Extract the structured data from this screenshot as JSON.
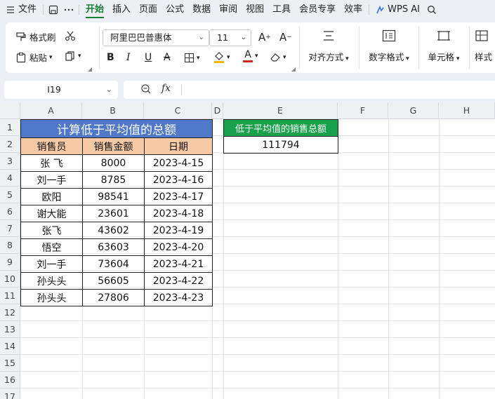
{
  "menu": {
    "items": [
      "文件",
      "开始",
      "插入",
      "页面",
      "公式",
      "数据",
      "审阅",
      "视图",
      "工具",
      "会员专享",
      "效率"
    ],
    "active": "开始",
    "wps_ai": "WPS AI"
  },
  "ribbon": {
    "format_painter": "格式刷",
    "paste": "粘贴",
    "font_name": "阿里巴巴普惠体",
    "font_size": "11",
    "bold": "B",
    "italic": "I",
    "underline": "U",
    "strike": "A",
    "font_color_glyph": "A",
    "grow_glyph": "A",
    "shrink_glyph": "A",
    "align": "对齐方式",
    "number_format": "数字格式",
    "cell": "单元格",
    "style": "样式"
  },
  "formula_bar": {
    "name_box": "I19",
    "fx": "fx",
    "formula": ""
  },
  "sheet": {
    "columns": [
      "A",
      "B",
      "C",
      "D",
      "E",
      "F",
      "G",
      "H"
    ],
    "rows": [
      "1",
      "2",
      "3",
      "4",
      "5",
      "6",
      "7",
      "8",
      "9",
      "10",
      "11",
      "12",
      "13",
      "14",
      "15",
      "16",
      "17"
    ],
    "title": "计算低于平均值的总额",
    "headers": [
      "销售员",
      "销售金额",
      "日期"
    ],
    "data": [
      [
        "张  飞",
        "8000",
        "2023-4-15"
      ],
      [
        "刘一手",
        "8785",
        "2023-4-16"
      ],
      [
        "欧阳",
        "98541",
        "2023-4-17"
      ],
      [
        "谢大能",
        "23601",
        "2023-4-18"
      ],
      [
        "张飞",
        "43602",
        "2023-4-19"
      ],
      [
        "悟空",
        "63603",
        "2023-4-20"
      ],
      [
        "刘一手",
        "73604",
        "2023-4-21"
      ],
      [
        "孙头头",
        "56605",
        "2023-4-22"
      ],
      [
        "孙头头",
        "27806",
        "2023-4-23"
      ]
    ],
    "result_label": "低于平均值的销售总额",
    "result_value": "111794"
  },
  "colors": {
    "accent_green": "#1a7f37",
    "title_blue": "#4f78c8",
    "header_peach": "#f7c9a5",
    "result_green": "#1aa14b"
  }
}
